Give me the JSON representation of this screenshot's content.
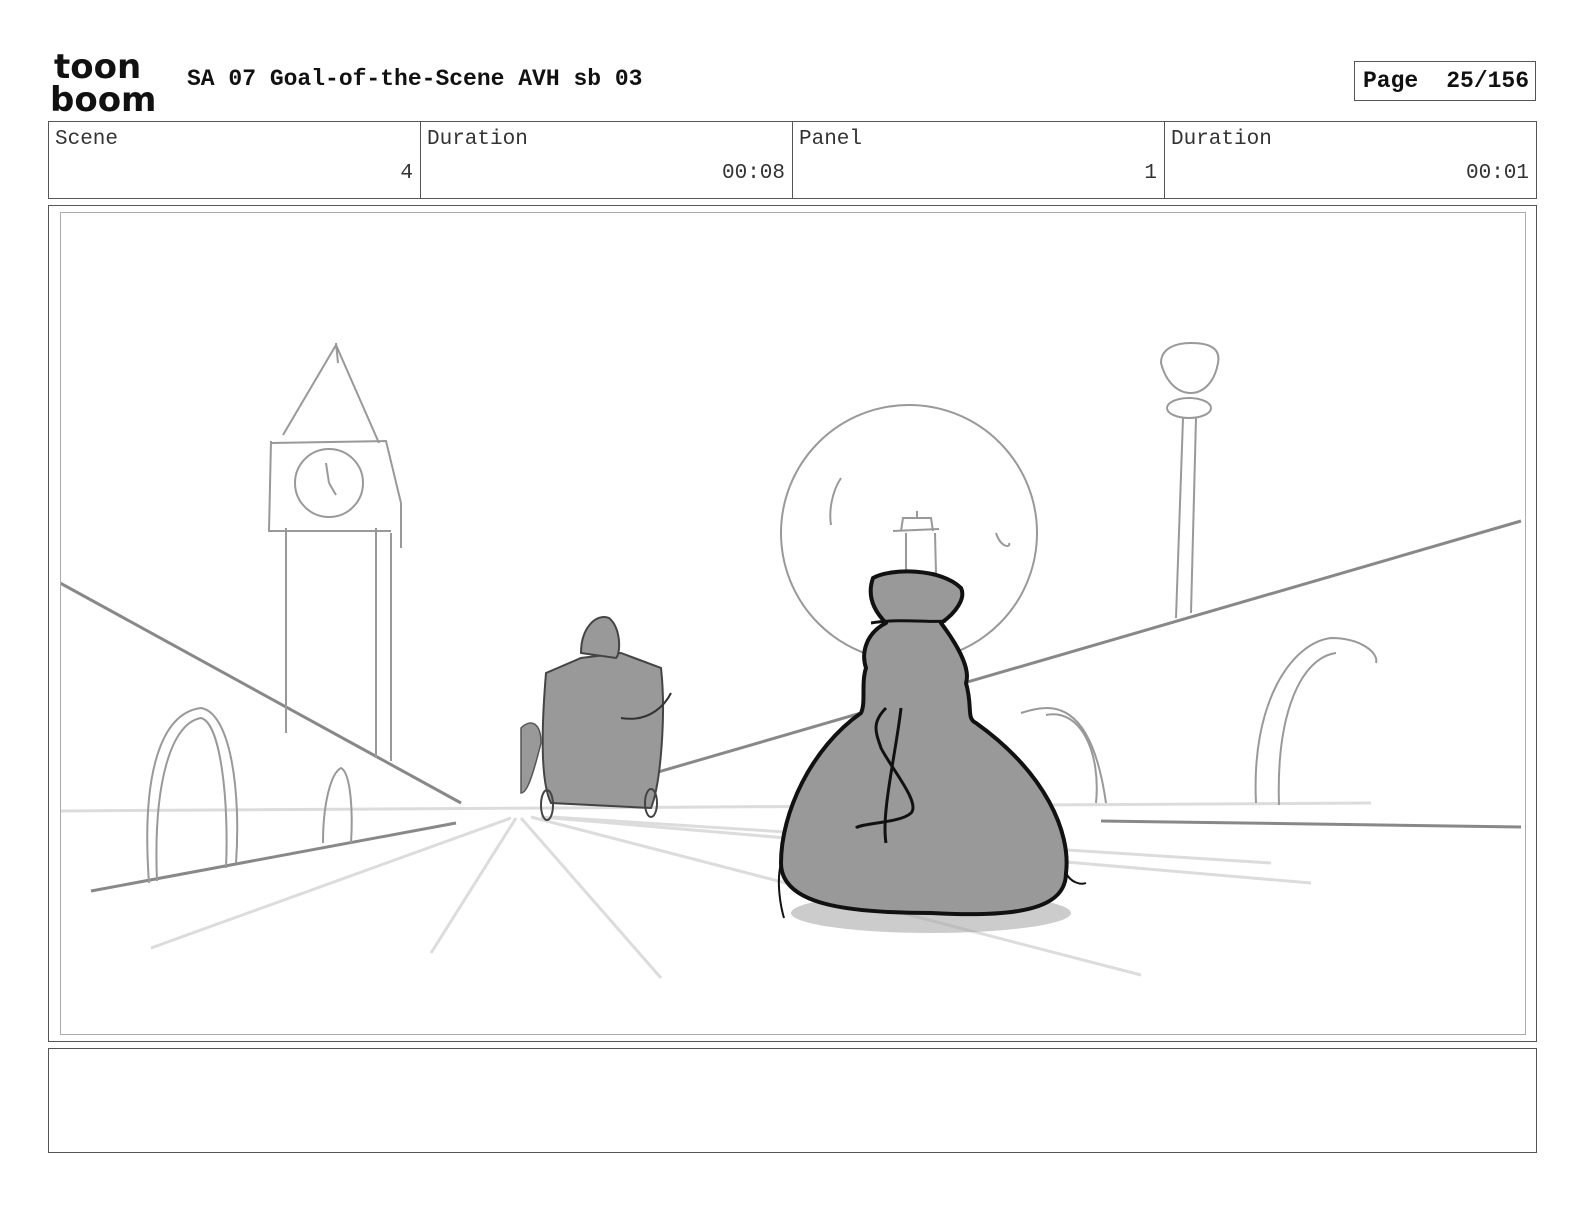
{
  "header": {
    "logo": {
      "line1": "toon",
      "line2": "boom"
    },
    "title": "SA 07 Goal-of-the-Scene AVH sb 03",
    "page_label": "Page",
    "page_value": "25/156"
  },
  "info": {
    "scene_label": "Scene",
    "scene_value": "4",
    "scene_duration_label": "Duration",
    "scene_duration_value": "00:08",
    "panel_label": "Panel",
    "panel_value": "1",
    "panel_duration_label": "Duration",
    "panel_duration_value": "00:01"
  },
  "notes": {
    "text": ""
  },
  "colors": {
    "border": "#555555",
    "sketch_line": "#999999",
    "fill_gray": "#999999",
    "ink": "#111111"
  }
}
